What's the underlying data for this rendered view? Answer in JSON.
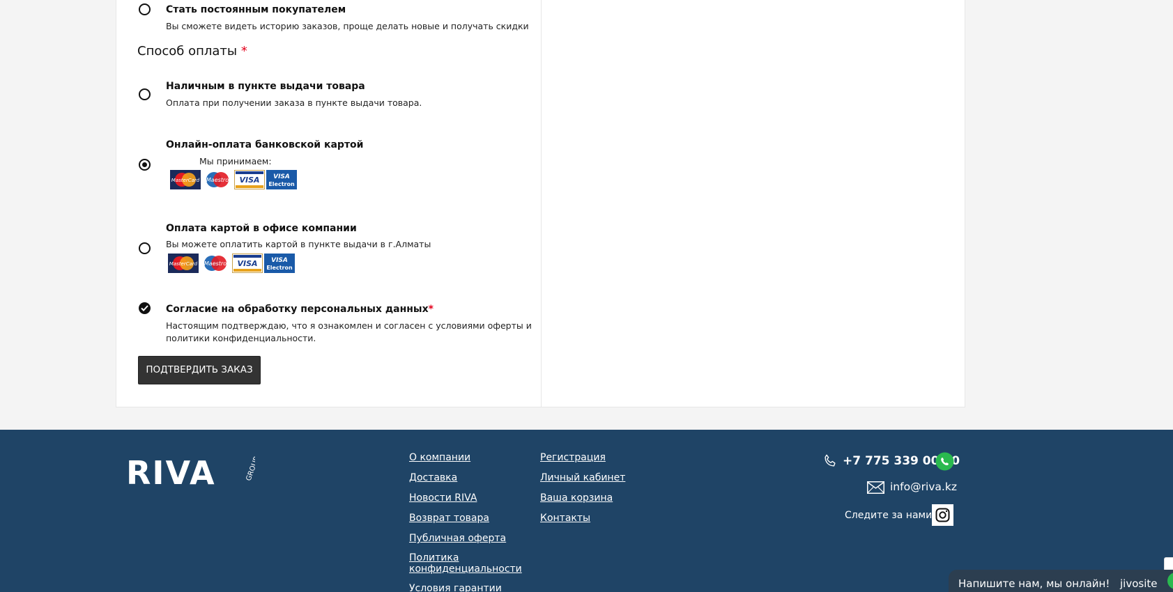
{
  "order": {
    "regular_customer": {
      "title": "Стать постоянным покупателем",
      "desc": "Вы сможете видеть историю заказов, проще делать новые и получать скидки"
    },
    "payment_title": "Способ оплаты",
    "required_mark": "*",
    "payment_options": [
      {
        "title": "Наличным в пункте выдачи товара",
        "desc": "Оплата при получении заказа в пункте выдачи товара.",
        "selected": false
      },
      {
        "title": "Онлайн-оплата банковской картой",
        "desc": "Мы принимаем:",
        "selected": true
      },
      {
        "title": "Оплата картой в офисе компании",
        "desc": "Вы можете оплатить картой в пункте выдачи в г.Алматы",
        "selected": false
      }
    ],
    "card_logos": [
      "MasterCard",
      "Maestro",
      "VISA",
      "VISA",
      "Electron"
    ],
    "consent": {
      "title": "Согласие на обработку персональных данных",
      "desc_line1": "Настоящим подтверждаю, что я ознакомлен и согласен с условиями оферты и",
      "desc_line2": "политики конфиденциальности.",
      "checked": true
    },
    "submit_label": "ПОДТВЕРДИТЬ ЗАКАЗ"
  },
  "footer": {
    "logo": "RIVA",
    "logo_sub": "GROUP",
    "col1": [
      "О компании",
      "Доставка",
      "Новости RIVA",
      "Возврат товара",
      "Публичная оферта",
      "Политика",
      "конфиденциальности",
      "Условия гарантии"
    ],
    "col2": [
      "Регистрация",
      "Личный кабинет",
      "Ваша корзина",
      "Контакты"
    ],
    "phone": "+7 775 339 00 00",
    "email": "info@riva.kz",
    "follow": "Следите за нами:"
  },
  "chat": {
    "text": "Напишите нам, мы онлайн!",
    "brand": "jivosite"
  },
  "colors": {
    "footer_bg": "#1f4466",
    "required": "#e3001b",
    "button_bg": "#333333",
    "whatsapp": "#2ab94f"
  }
}
